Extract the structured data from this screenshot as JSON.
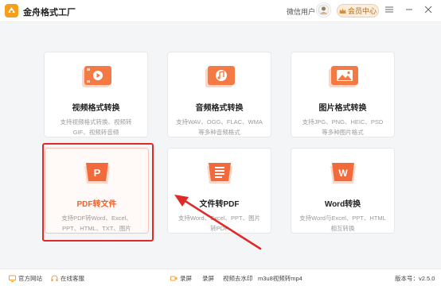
{
  "app": {
    "title": "金舟格式工厂",
    "user_name": "微信用户",
    "vip_label": "会员中心"
  },
  "cards": [
    {
      "title": "视频格式转换",
      "desc": "支持视频格式转换、视频转GIF、视频转音频",
      "icon": "video-format-icon"
    },
    {
      "title": "音频格式转换",
      "desc": "支持WAV、OGG、FLAC、WMA等多种音频格式",
      "icon": "audio-format-icon"
    },
    {
      "title": "图片格式转换",
      "desc": "支持JPG、PNG、HEIC、PSD等多种图片格式",
      "icon": "image-format-icon"
    },
    {
      "title": "PDF转文件",
      "desc": "支持PDF转Word、Excel、PPT、HTML、TXT、图片",
      "icon": "pdf-convert-icon",
      "letter": "P"
    },
    {
      "title": "文件转PDF",
      "desc": "支持Word、Excel、PPT、图片转PDF",
      "icon": "file-to-pdf-icon"
    },
    {
      "title": "Word转换",
      "desc": "支持Word与Excel、PPT、HTML相互转换",
      "icon": "word-convert-icon",
      "letter": "W"
    }
  ],
  "statusbar": {
    "website": "官方网站",
    "support": "在线客服",
    "record": "录屏",
    "record2": "录屏",
    "watermark": "视频去水印",
    "m3u8": "m3u8视频转mp4",
    "version": "版本号：v2.5.0"
  },
  "colors": {
    "accent": "#f2612c",
    "highlight": "#e02a2a",
    "vip_bg": "#fcecd9"
  }
}
